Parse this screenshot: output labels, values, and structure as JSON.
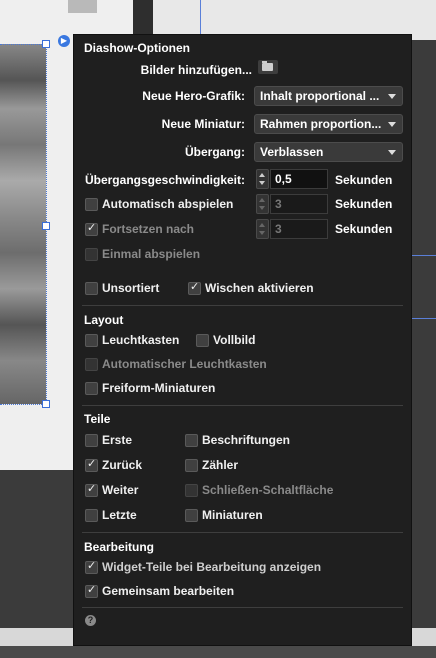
{
  "panel": {
    "title": "Diashow-Optionen",
    "add_images_label": "Bilder hinzufügen...",
    "hero_label": "Neue Hero-Grafik:",
    "hero_value": "Inhalt proportional ...",
    "thumb_label": "Neue Miniatur:",
    "thumb_value": "Rahmen proportion...",
    "transition_label": "Übergang:",
    "transition_value": "Verblassen",
    "speed_label": "Übergangsgeschwindigkeit:",
    "speed_value": "0,5",
    "speed_unit": "Sekunden",
    "autoplay_label": "Automatisch abspielen",
    "autoplay_checked": false,
    "autoplay_value": "3",
    "autoplay_unit": "Sekunden",
    "continue_label": "Fortsetzen nach",
    "continue_checked": true,
    "continue_value": "3",
    "continue_unit": "Sekunden",
    "play_once_label": "Einmal abspielen",
    "unsorted_label": "Unsortiert",
    "swipe_label": "Wischen aktivieren",
    "swipe_checked": true
  },
  "layout": {
    "title": "Layout",
    "lightbox_label": "Leuchtkasten",
    "fullscreen_label": "Vollbild",
    "auto_lightbox_label": "Automatischer Leuchtkasten",
    "freeform_label": "Freiform-Miniaturen"
  },
  "parts": {
    "title": "Teile",
    "first_label": "Erste",
    "captions_label": "Beschriftungen",
    "back_label": "Zurück",
    "back_checked": true,
    "counter_label": "Zähler",
    "next_label": "Weiter",
    "next_checked": true,
    "close_label": "Schließen-Schaltfläche",
    "last_label": "Letzte",
    "thumbnails_label": "Miniaturen"
  },
  "editing": {
    "title": "Bearbeitung",
    "show_parts_label": "Widget-Teile bei Bearbeitung anzeigen",
    "show_parts_checked": true,
    "edit_together_label": "Gemeinsam bearbeiten",
    "edit_together_checked": true
  },
  "icons": {
    "folder": "folder-icon",
    "help": "help-icon",
    "widget_arrow": "arrow-right-icon"
  },
  "colors": {
    "panel_bg": "#1f1f1f",
    "selection": "#3a78e0"
  }
}
